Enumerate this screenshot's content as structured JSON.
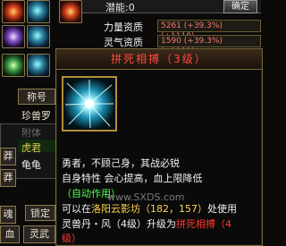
{
  "topbar": {
    "potential_label": "潜能:",
    "potential_value": "0",
    "confirm_label": "确定"
  },
  "stats": [
    {
      "label": "力量资质",
      "value": "5261 (+39.3%) (+1118)"
    },
    {
      "label": "灵气资质",
      "value": "1590 (+39.3%) (+1111)"
    }
  ],
  "left_panel": {
    "title_button": "称号",
    "pet_label": "珍兽罗",
    "item_1": "附体",
    "item_2": "虎君",
    "item_3": "龟龟",
    "side_tab_1": "莽",
    "side_tab_2": "莽",
    "side_tab_3": "魂",
    "lock_button": "锁定",
    "bottom_tab_1": "血",
    "bottom_tab_2": "灵武"
  },
  "tooltip": {
    "title": "拼死相搏（3级）",
    "line1": "勇者，不顾己身，其战必锐",
    "line2": "自身特性 会心提高，血上限降低",
    "line3": "（自动作用）",
    "line4_prefix": "可以在",
    "line4_location": "洛阳云影坊（182，157）",
    "line4_suffix": "处使用",
    "line5_prefix": "灵兽丹・风（4级）升级为",
    "line5_skill": "拼死相搏（4",
    "line6": "级）"
  },
  "watermark": "www.SXDS.com",
  "colors": {
    "title_red": "#ff4a3d",
    "highlight_yellow": "#ffd64a",
    "auto_green": "#53ff53"
  }
}
